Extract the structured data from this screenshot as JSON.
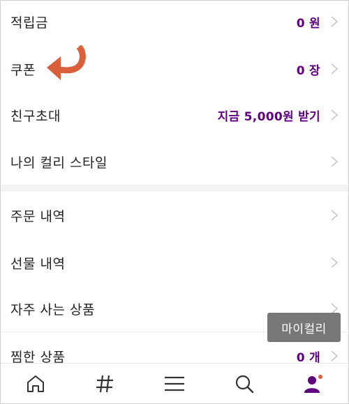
{
  "menu": {
    "items": [
      {
        "label": "적립금",
        "value": "0 원"
      },
      {
        "label": "쿠폰",
        "value": "0 장"
      },
      {
        "label": "친구초대",
        "value": "지금 5,000원 받기"
      },
      {
        "label": "나의 컬리 스타일",
        "value": ""
      },
      {
        "label": "주문 내역",
        "value": ""
      },
      {
        "label": "선물 내역",
        "value": ""
      },
      {
        "label": "자주 사는 상품",
        "value": ""
      },
      {
        "label": "찜한 상품",
        "value": "0 개"
      }
    ]
  },
  "tooltip": {
    "label": "마이컬리"
  },
  "tabbar": {
    "tabs": [
      {
        "icon": "home-icon"
      },
      {
        "icon": "hashtag-icon"
      },
      {
        "icon": "menu-icon"
      },
      {
        "icon": "search-icon"
      },
      {
        "icon": "user-icon",
        "active": true
      }
    ]
  },
  "colors": {
    "accent": "#5f0080",
    "arrow": "#d9603b",
    "tooltip_bg": "#777777",
    "band": "#f3f3f3"
  }
}
